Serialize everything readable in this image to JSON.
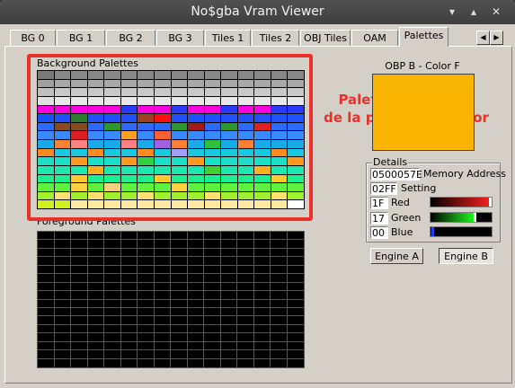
{
  "window": {
    "title": "No$gba Vram Viewer",
    "minimize_icon": "chevron-down-icon",
    "restore_icon": "chevron-up-icon",
    "close_icon": "close-icon"
  },
  "tabs": [
    {
      "label": "BG 0"
    },
    {
      "label": "BG 1"
    },
    {
      "label": "BG 2"
    },
    {
      "label": "BG 3"
    },
    {
      "label": "Tiles 1"
    },
    {
      "label": "Tiles 2"
    },
    {
      "label": "OBJ Tiles"
    },
    {
      "label": "OAM"
    },
    {
      "label": "Palettes",
      "active": true
    }
  ],
  "tab_scroll": {
    "left": "◀",
    "right": "▶"
  },
  "background_palettes": {
    "label": "Background Palettes",
    "colors": [
      [
        "#787878",
        "#888888",
        "#888888",
        "#888888",
        "#888888",
        "#888888",
        "#888888",
        "#888888",
        "#888888",
        "#888888",
        "#888888",
        "#888888",
        "#888888",
        "#888888",
        "#888888",
        "#888888"
      ],
      [
        "#a0a0a0",
        "#a8a8a8",
        "#a8a8a8",
        "#a8a8a8",
        "#a8a8a8",
        "#a8a8a8",
        "#a8a8a8",
        "#a8a8a8",
        "#a8a8a8",
        "#a8a8a8",
        "#a8a8a8",
        "#a8a8a8",
        "#a8a8a8",
        "#a8a8a8",
        "#a8a8a8",
        "#a8a8a8"
      ],
      [
        "#c0c0c0",
        "#c8c8c8",
        "#c8c8c8",
        "#c8c8c8",
        "#c8c8c8",
        "#c8c8c8",
        "#c8c8c8",
        "#c8c8c8",
        "#c8c8c8",
        "#c8c8c8",
        "#c8c8c8",
        "#c8c8c8",
        "#c8c8c8",
        "#c8c8c8",
        "#c8c8c8",
        "#c8c8c8"
      ],
      [
        "#e0e0e0",
        "#e8e8e8",
        "#e8e8e8",
        "#e8e8e8",
        "#e8e8e8",
        "#e8e8e8",
        "#e8e8e8",
        "#e8e8e8",
        "#e8e8e8",
        "#e8e8e8",
        "#e8e8e8",
        "#e8e8e8",
        "#e8e8e8",
        "#e8e8e8",
        "#e8e8e8",
        "#e8e8e8"
      ],
      [
        "#ff00e0",
        "#ff00e0",
        "#ff00e0",
        "#ff00e0",
        "#ff00e0",
        "#2a3bff",
        "#ff00e0",
        "#ff00e0",
        "#2a3bff",
        "#ff00e0",
        "#ff00e0",
        "#2a3bff",
        "#ff00e0",
        "#ff00e0",
        "#2a3bff",
        "#2a3bff"
      ],
      [
        "#1a50ff",
        "#2050ff",
        "#2a7a30",
        "#2050ff",
        "#2050ff",
        "#2050ff",
        "#a04020",
        "#ff1010",
        "#2050ff",
        "#2050ff",
        "#2050ff",
        "#2050ff",
        "#2050ff",
        "#2050ff",
        "#2050ff",
        "#2050ff"
      ],
      [
        "#2a6aff",
        "#8a4a20",
        "#8a4a20",
        "#2a6aff",
        "#2a9a30",
        "#2a6aff",
        "#2a6aff",
        "#2a6aff",
        "#2a9a30",
        "#a01a1a",
        "#2a6aff",
        "#2a9a30",
        "#2a6aff",
        "#e02020",
        "#2a6aff",
        "#2a6aff"
      ],
      [
        "#3a8aff",
        "#3a8aff",
        "#e02020",
        "#3a8aff",
        "#3a8aff",
        "#ffa020",
        "#3a8aff",
        "#ff6030",
        "#3a8aff",
        "#3a8aff",
        "#3a8aff",
        "#3a8aff",
        "#3a8aff",
        "#3a8aff",
        "#3a8aff",
        "#3a8aff"
      ],
      [
        "#1aaae8",
        "#ff8030",
        "#ff8080",
        "#1aaae8",
        "#1aaae8",
        "#ff8080",
        "#1aaae8",
        "#a060e0",
        "#ff8030",
        "#1aaae8",
        "#30c040",
        "#1aaae8",
        "#ff8030",
        "#1aaae8",
        "#1aaae8",
        "#1aaae8"
      ],
      [
        "#ff8a20",
        "#1ac8e0",
        "#1ac8e0",
        "#ff8a20",
        "#1ac8e0",
        "#1ac8e0",
        "#ff8a20",
        "#1ac8e0",
        "#a0a0ff",
        "#1ac8e0",
        "#1ac8e0",
        "#1ac8e0",
        "#1ac8e0",
        "#1ac8e0",
        "#ff8a20",
        "#1ac8e0"
      ],
      [
        "#1ae0c8",
        "#1ae0c8",
        "#ff9a20",
        "#1ae0c8",
        "#1ae0c8",
        "#ff9a20",
        "#30d040",
        "#1ae0c8",
        "#1ae0c8",
        "#ff9a20",
        "#1ae0c8",
        "#1ae0c8",
        "#1ae0c8",
        "#1ae0c8",
        "#1ae0c8",
        "#ff9a20"
      ],
      [
        "#1ae8b0",
        "#1ae8b0",
        "#1ae8b0",
        "#ffb020",
        "#1ae8b0",
        "#1ae8b0",
        "#1ae8b0",
        "#1ae8b0",
        "#1ae8b0",
        "#1ae8b0",
        "#40d030",
        "#1ae8b0",
        "#1ae8b0",
        "#ffb020",
        "#1ae8b0",
        "#1ae8b0"
      ],
      [
        "#1af090",
        "#1af090",
        "#ffc830",
        "#1af090",
        "#1af090",
        "#1af090",
        "#1af090",
        "#ffc830",
        "#1af090",
        "#1af090",
        "#1af090",
        "#1af090",
        "#1af090",
        "#1af090",
        "#ffc830",
        "#1af090"
      ],
      [
        "#60f040",
        "#60f040",
        "#ffd040",
        "#60f040",
        "#ffd080",
        "#60f040",
        "#60f040",
        "#60f040",
        "#ffd040",
        "#60f040",
        "#60f040",
        "#60f040",
        "#60f040",
        "#60f040",
        "#60f040",
        "#60f040"
      ],
      [
        "#a0f030",
        "#ffe070",
        "#a0f030",
        "#ffe070",
        "#a0f030",
        "#a0f030",
        "#ffe070",
        "#a0f030",
        "#a0f030",
        "#a0f030",
        "#ffe070",
        "#a0f030",
        "#a0f030",
        "#a0f030",
        "#ffe070",
        "#a0f030"
      ],
      [
        "#d0f020",
        "#d0f020",
        "#ffe8a0",
        "#ffe8a0",
        "#ffe8a0",
        "#ffe8a0",
        "#ffe8a0",
        "#ffe8a0",
        "#ffe8a0",
        "#ffe8a0",
        "#ffe8a0",
        "#ffe8a0",
        "#ffe8a0",
        "#ffe8a0",
        "#ffe8a0",
        "#ffffff"
      ]
    ]
  },
  "foreground_palettes": {
    "label": "Foreground Palettes"
  },
  "annotation": {
    "line1": "Paletas de fondos",
    "line2": "de la pantalla inferior"
  },
  "selected_color": {
    "label": "OBP B - Color F",
    "color": "#f8b400"
  },
  "details": {
    "title": "Details",
    "memory_address": {
      "value": "0500057E",
      "label": "Memory Address"
    },
    "setting": {
      "value": "02FF",
      "label": "Setting"
    },
    "red": {
      "value": "1F",
      "label": "Red",
      "level": 1.0
    },
    "green": {
      "value": "17",
      "label": "Green",
      "level": 0.74
    },
    "blue": {
      "value": "00",
      "label": "Blue",
      "level": 0.0
    }
  },
  "engine_a": {
    "label": "Engine A"
  },
  "engine_b": {
    "label": "Engine B",
    "pressed": true
  }
}
